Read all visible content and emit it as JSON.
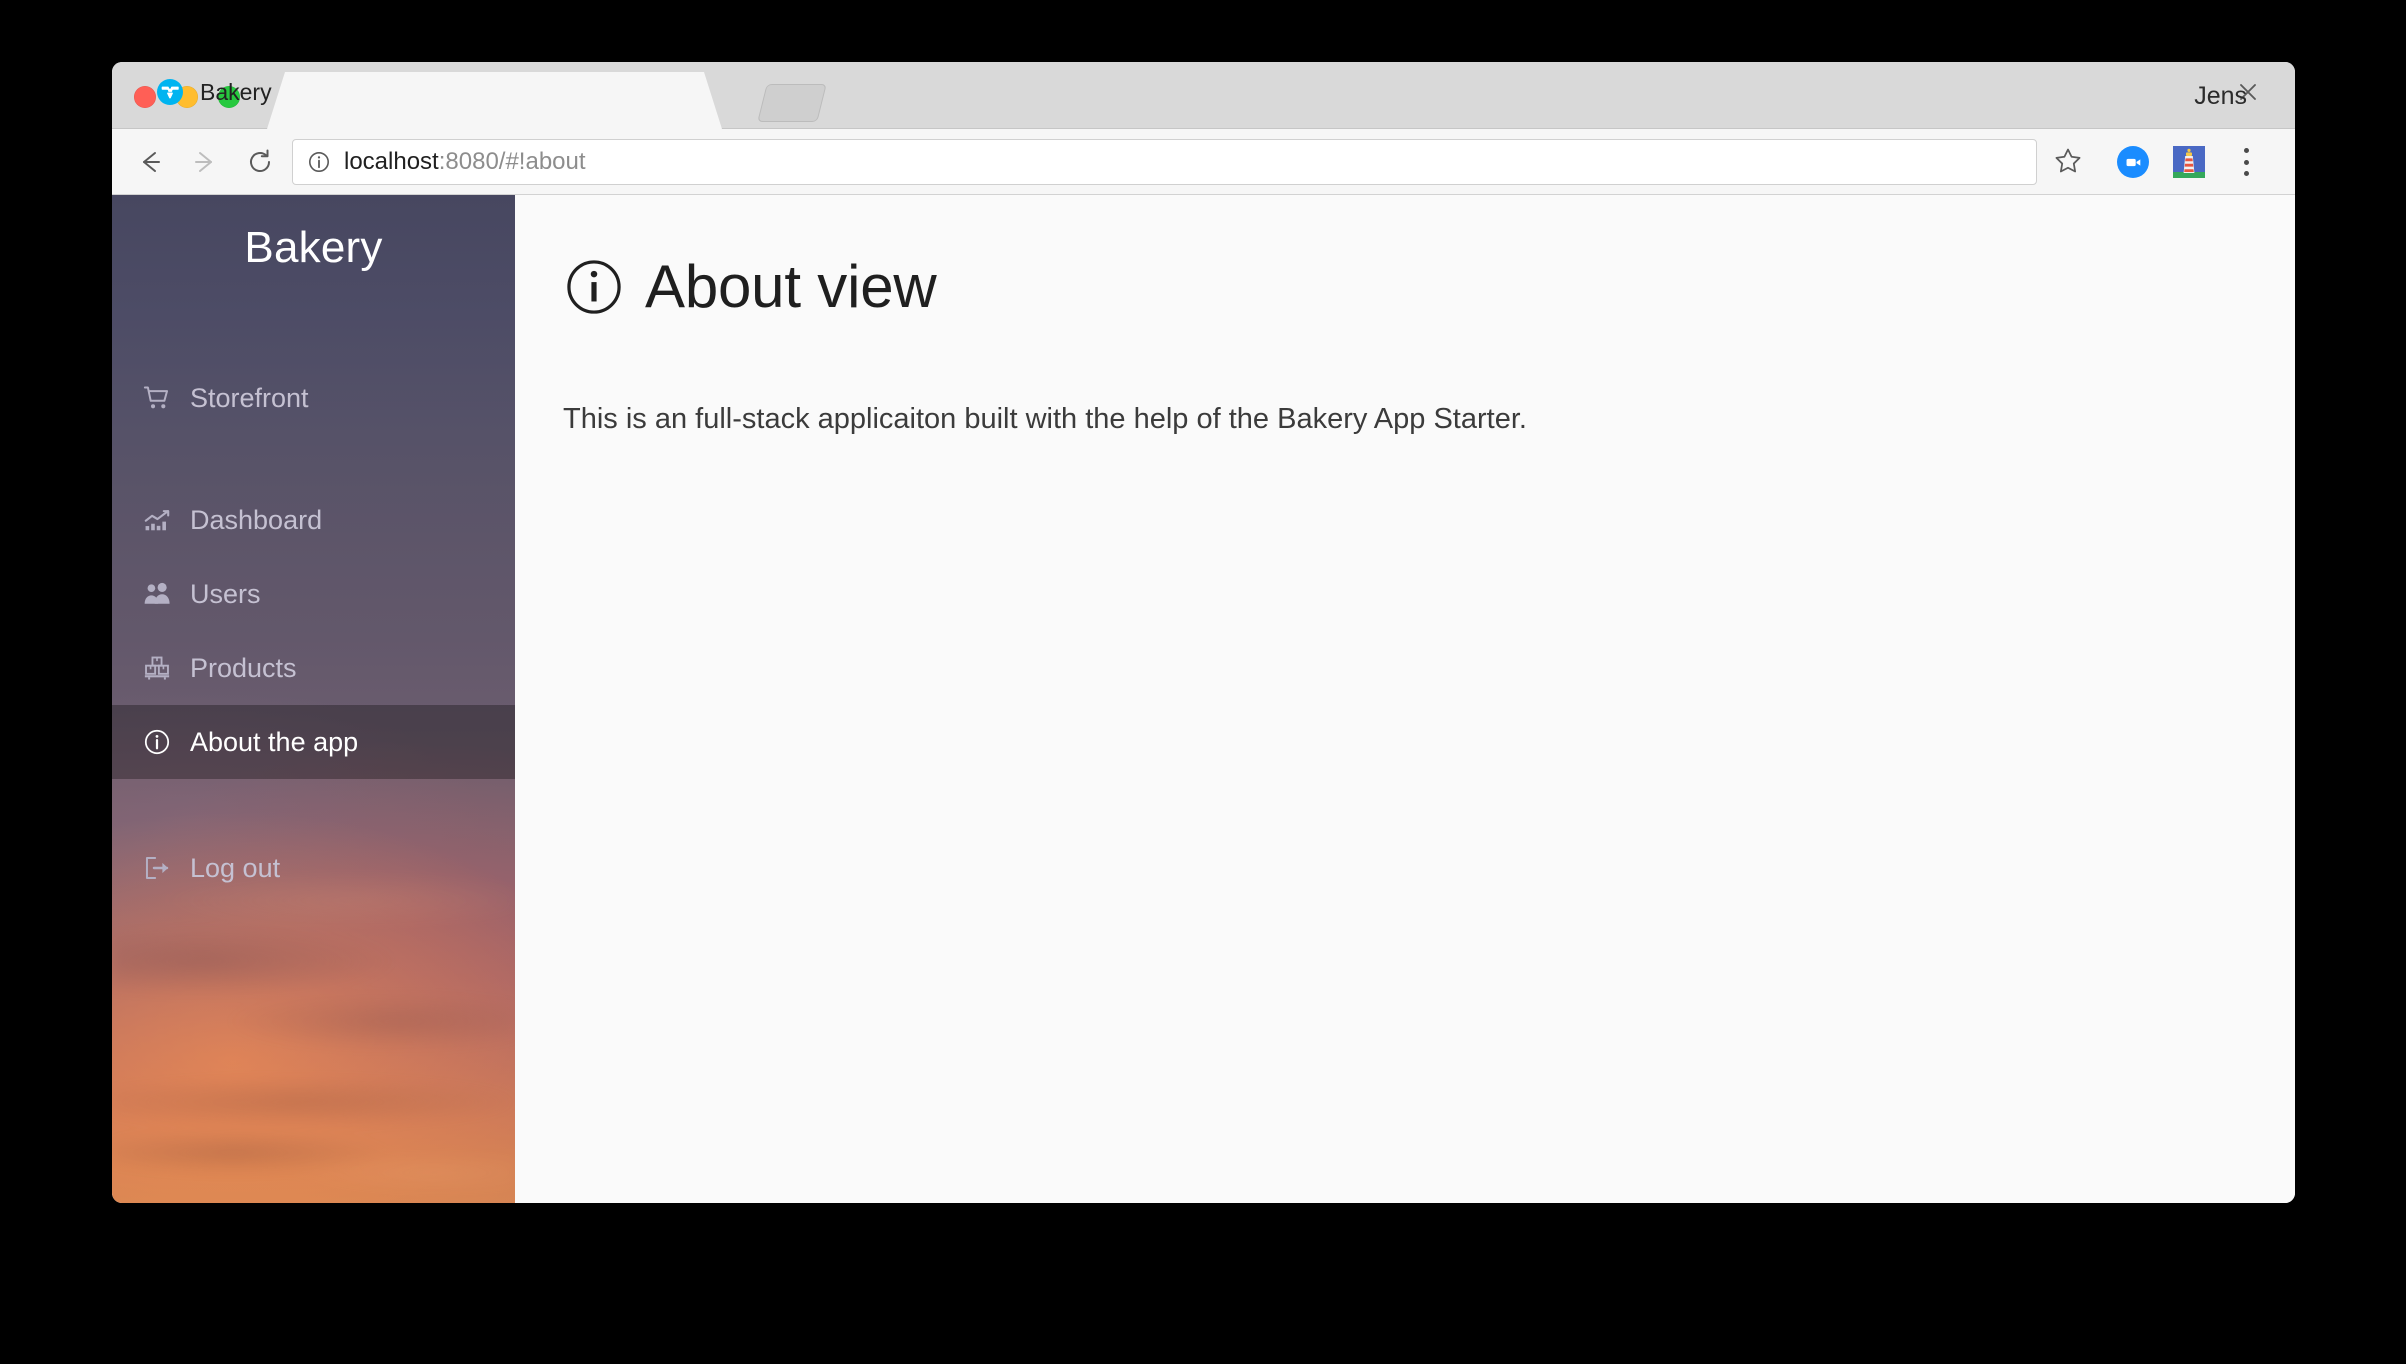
{
  "window": {
    "profile_name": "Jens"
  },
  "tab": {
    "title": "Bakery",
    "favicon_name": "vaadin-logo-icon",
    "close_label": "×"
  },
  "toolbar": {
    "back_name": "back-arrow-icon",
    "forward_name": "forward-arrow-icon",
    "reload_name": "reload-icon",
    "url_scheme_info": "site-info-icon",
    "url_host": "localhost",
    "url_rest": ":8080/#!about",
    "url_full": "localhost:8080/#!about",
    "bookmark_name": "star-icon",
    "extension_1_name": "video-camera-icon",
    "extension_2_name": "lighthouse-icon",
    "menu_name": "three-dot-menu-icon"
  },
  "sidebar": {
    "app_title": "Bakery",
    "items": [
      {
        "label": "Storefront",
        "icon": "shopping-cart-icon",
        "selected": false
      },
      {
        "label": "Dashboard",
        "icon": "chart-icon",
        "selected": false
      },
      {
        "label": "Users",
        "icon": "users-icon",
        "selected": false
      },
      {
        "label": "Products",
        "icon": "boxes-icon",
        "selected": false
      },
      {
        "label": "About the app",
        "icon": "info-circle-icon",
        "selected": true
      },
      {
        "label": "Log out",
        "icon": "sign-out-icon",
        "selected": false
      }
    ],
    "colors": {
      "top": "#474760",
      "bottom": "#d48454",
      "selected_overlay": "rgba(0,0,0,0.30)",
      "label": "#c5c1d2",
      "label_selected": "#ffffff"
    }
  },
  "main": {
    "heading_icon": "info-circle-icon",
    "heading": "About view",
    "body": "This is an full-stack applicaiton built with the help of the Bakery App Starter.",
    "background": "#fafafa"
  }
}
